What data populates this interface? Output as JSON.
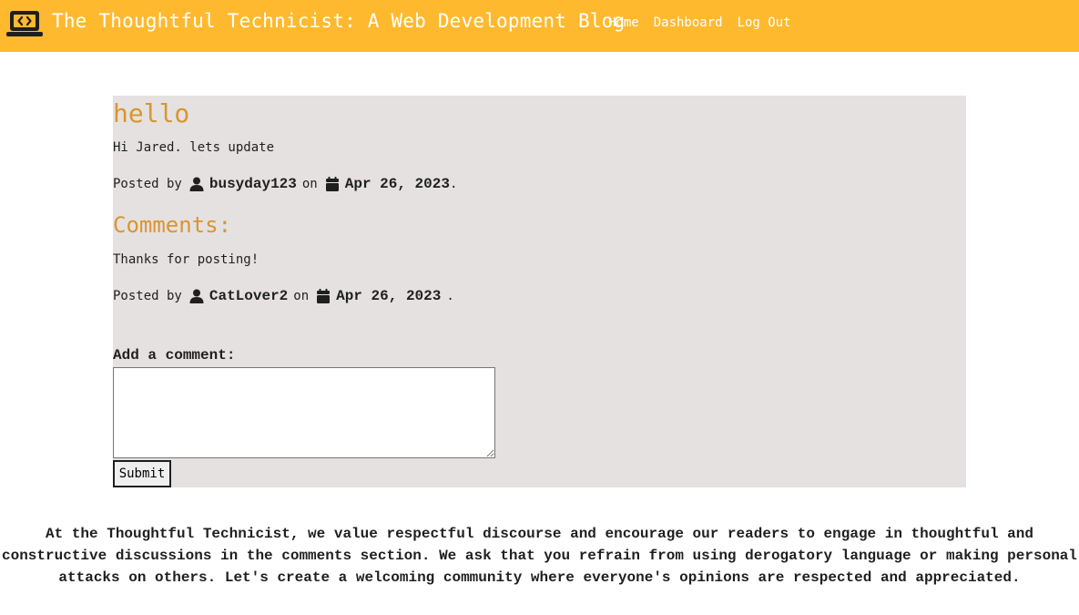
{
  "header": {
    "logo_icon": "laptop-code-icon",
    "site_title": "The Thoughtful Technicist: A Web Development Blog",
    "nav": [
      {
        "label": "Home"
      },
      {
        "label": "Dashboard"
      },
      {
        "label": "Log Out"
      }
    ],
    "background_color": "#ffb92f"
  },
  "post": {
    "title": "hello",
    "body": "Hi Jared. lets update",
    "meta": {
      "posted_by_label": "Posted by",
      "author": "busyday123",
      "on_label": "on",
      "date": "Apr 26, 2023",
      "trailing": "."
    },
    "background_color": "#e5e1e1",
    "accent_color": "#d99531"
  },
  "comments": {
    "heading": "Comments:",
    "items": [
      {
        "text": "Thanks for posting!",
        "posted_by_label": "Posted by",
        "author": "CatLover2",
        "on_label": "on",
        "date": "Apr 26, 2023",
        "trailing": "."
      }
    ]
  },
  "comment_form": {
    "label": "Add a comment:",
    "value": "",
    "submit_label": "Submit"
  },
  "footer": {
    "note": "At the Thoughtful Technicist, we value respectful discourse and encourage our readers to engage in thoughtful and constructive discussions in the comments section. We ask that you refrain from using derogatory language or making personal attacks on others. Let's create a welcoming community where everyone's opinions are respected and appreciated."
  }
}
